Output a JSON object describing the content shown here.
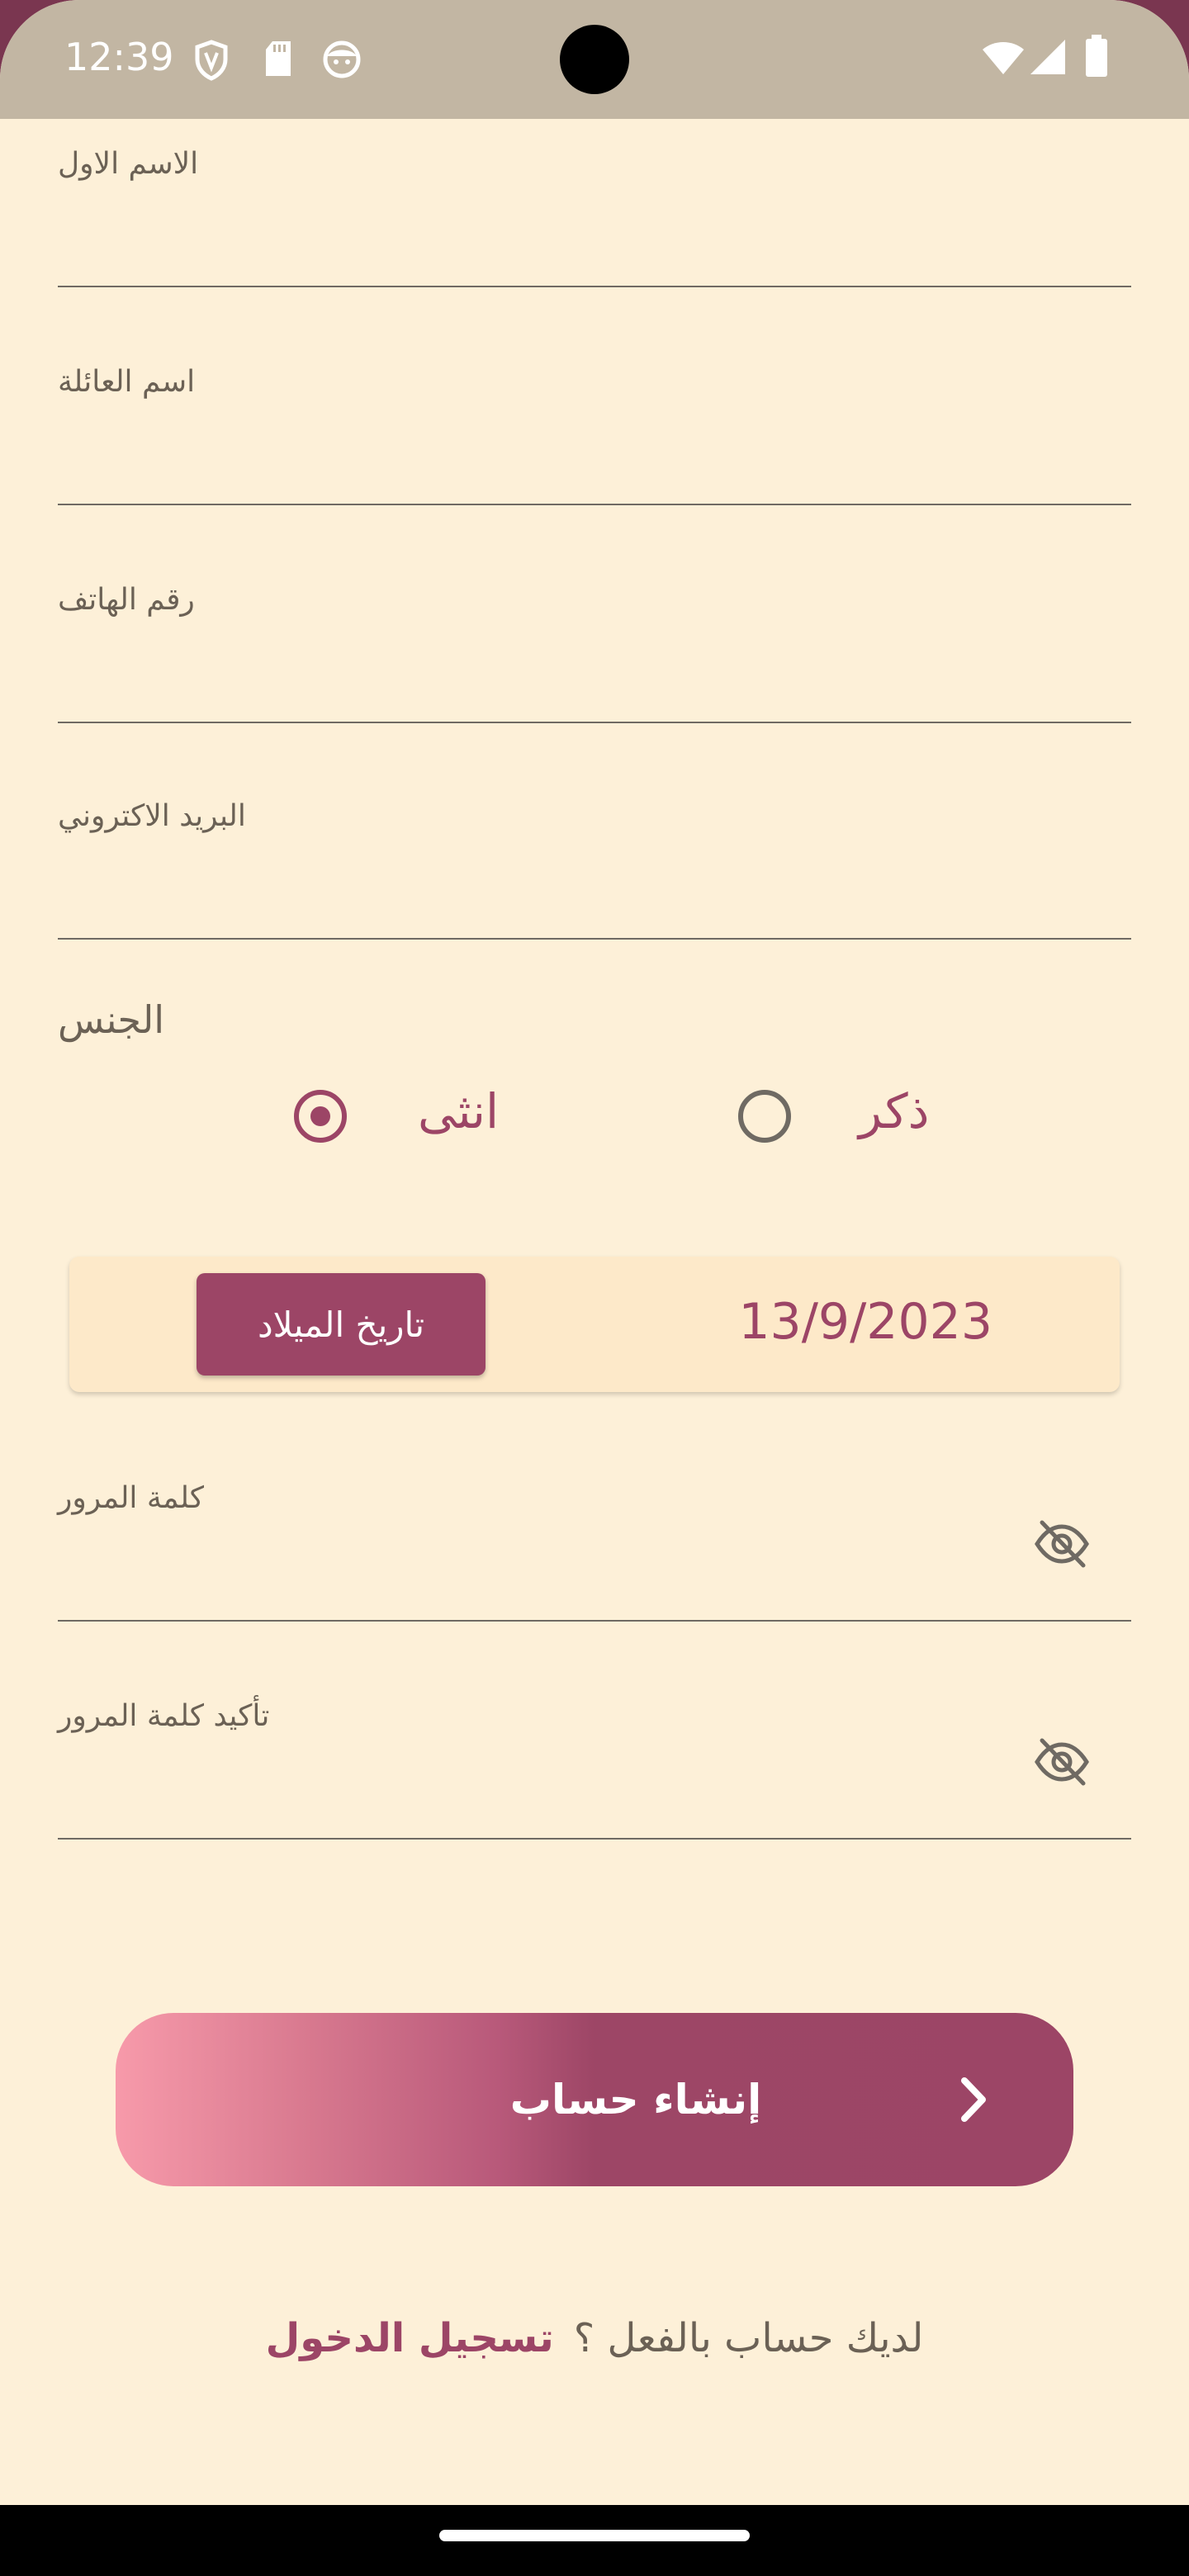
{
  "status_bar": {
    "time": "12:39",
    "left_icons": [
      "shield-icon",
      "sd-card-icon",
      "face-icon"
    ],
    "right_icons": [
      "wifi-icon",
      "signal-icon",
      "battery-icon"
    ]
  },
  "form": {
    "first_name_label": "الاسم الاول",
    "first_name_value": "",
    "last_name_label": "اسم العائلة",
    "last_name_value": "",
    "phone_label": "رقم الهاتف",
    "phone_value": "",
    "email_label": "البريد الاكتروني",
    "email_value": "",
    "password_label": "كلمة المرور",
    "password_value": "",
    "confirm_password_label": "تأكيد كلمة المرور",
    "confirm_password_value": ""
  },
  "gender": {
    "label": "الجنس",
    "options": [
      {
        "label": "ذكر",
        "selected": false
      },
      {
        "label": "انثى",
        "selected": true
      }
    ]
  },
  "birth_date": {
    "button_label": "تاريخ الميلاد",
    "value": "13/9/2023"
  },
  "actions": {
    "create_account_label": "إنشاء حساب",
    "login_question": "لديك حساب بالفعل ؟",
    "login_link": "تسجيل الدخول"
  },
  "colors": {
    "accent": "#9c4566",
    "background": "#fdf0d8",
    "gradient_start": "#f79aaa",
    "status_bar": "#c2b6a3"
  }
}
